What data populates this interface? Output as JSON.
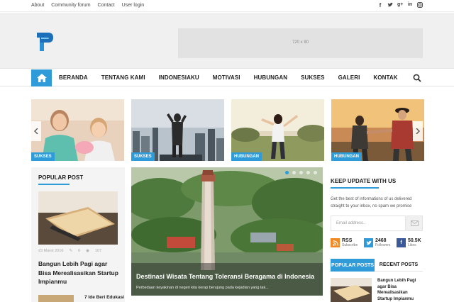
{
  "topbar": {
    "links": [
      "About",
      "Community forum",
      "Contact",
      "User login"
    ],
    "social_icons": [
      "facebook-icon",
      "twitter-icon",
      "google-plus-icon",
      "linkedin-icon",
      "instagram-icon"
    ]
  },
  "header": {
    "ad_label": "720 x 90"
  },
  "nav": {
    "items": [
      "BERANDA",
      "TENTANG KAMI",
      "INDONESIAKU",
      "MOTIVASI",
      "HUBUNGAN",
      "SUKSES",
      "GALERI",
      "KONTAK"
    ]
  },
  "slider": {
    "tags": [
      "SUKSES",
      "SUKSES",
      "HUBUNGAN",
      "HUBUNGAN"
    ]
  },
  "popular_post": {
    "heading": "POPULAR POST",
    "meta_date": "23 Maret 2016",
    "meta_comments": "6",
    "meta_views": "107",
    "title": "Bangun Lebih Pagi agar Bisa Merealisasikan Startup Impianmu",
    "second_title": "7 Ide Beri Edukasi"
  },
  "feature": {
    "title": "Destinasi Wisata Tentang Toleransi Beragama di Indonesia",
    "snippet": "Perbedaan keyakinan di negeri kita kerap berujung pada kejadian yang tak..."
  },
  "sidebar": {
    "heading": "KEEP UPDATE WITH US",
    "text": "Get the best of informations of us delivered straight to your inbox, no spam we promise",
    "email_placeholder": "Email address..",
    "stats": [
      {
        "num": "RSS",
        "label": "Subscribe",
        "color": "#f08a24"
      },
      {
        "num": "2468",
        "label": "Followers",
        "color": "#2f9bd8"
      },
      {
        "num": "50.5K",
        "label": "Likes",
        "color": "#3b5998"
      }
    ],
    "tab_active": "POPULAR POSTS",
    "tab_inactive": "RECENT POSTS",
    "recent_title": "Bangun Lebih Pagi agar Bisa Merealisasikan Startup Impianmu"
  },
  "colors": {
    "accent": "#2f9bd8"
  }
}
